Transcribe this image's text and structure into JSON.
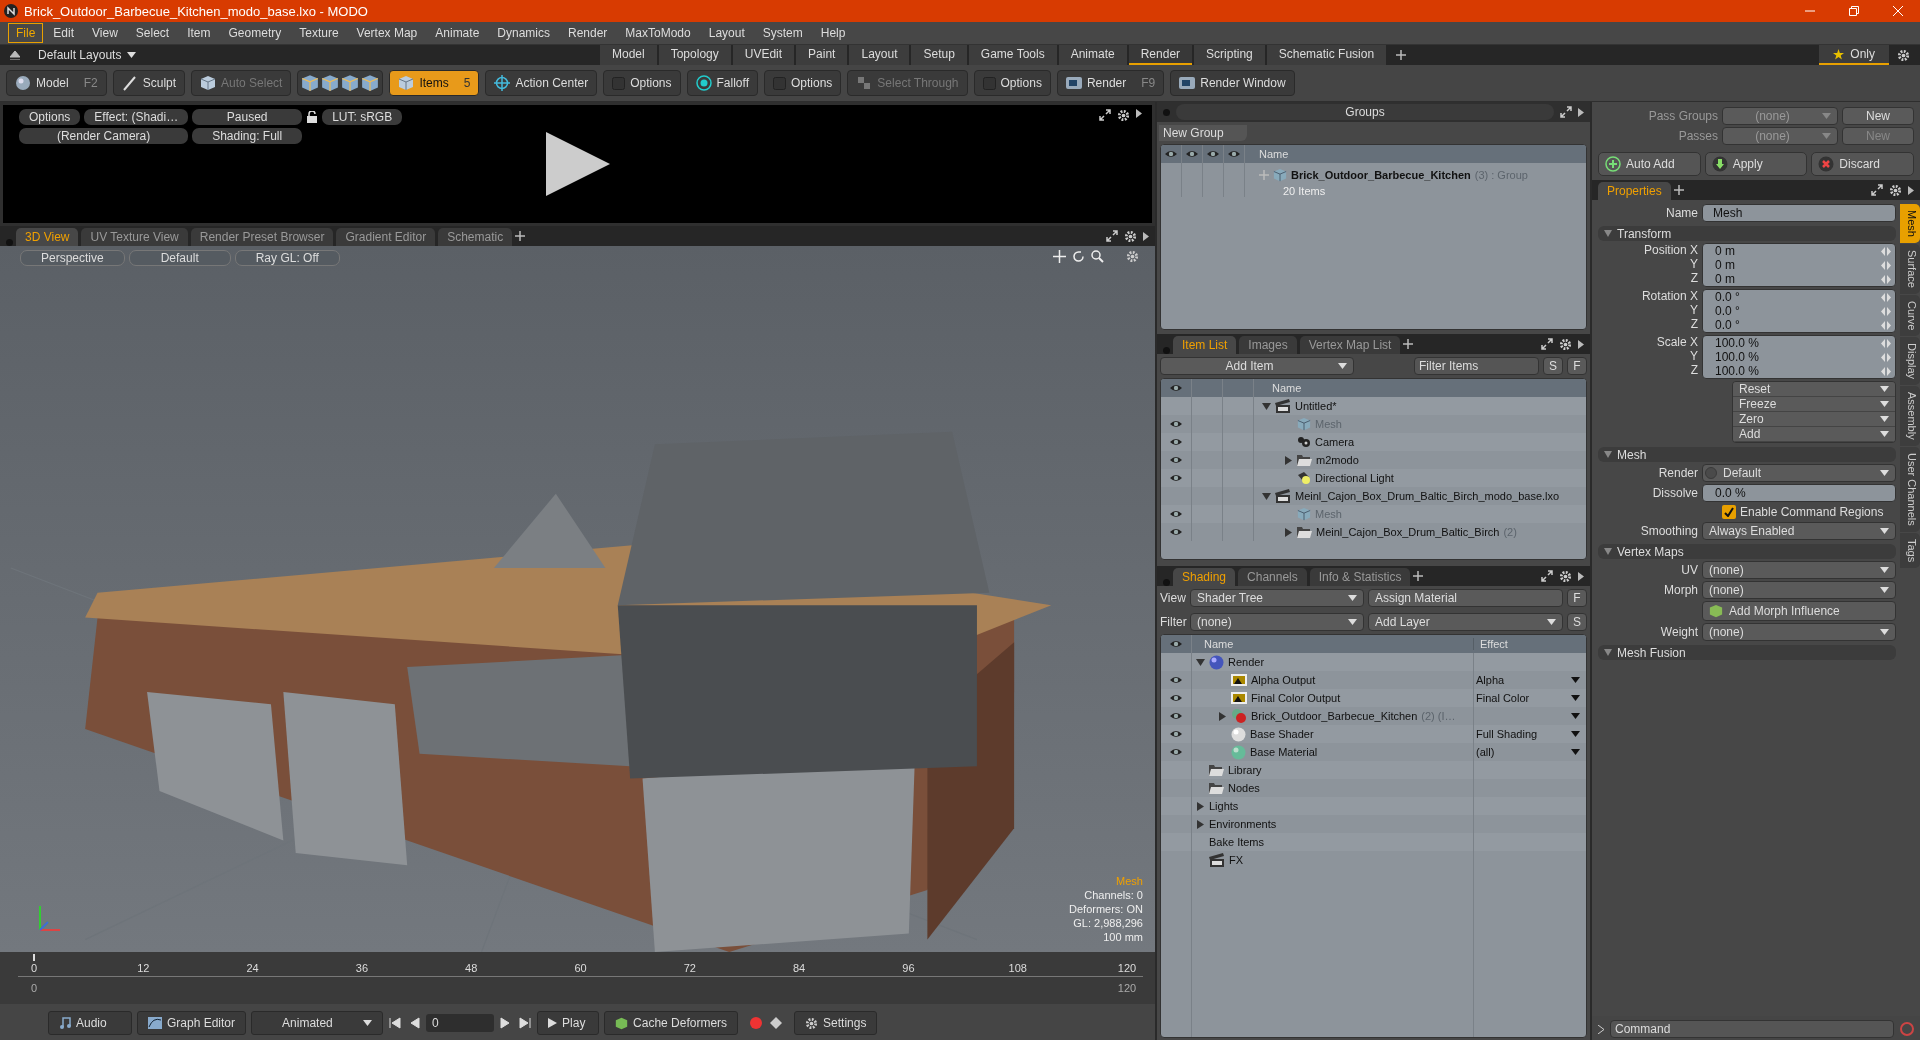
{
  "window": {
    "title": "Brick_Outdoor_Barbecue_Kitchen_modo_base.lxo - MODO"
  },
  "menu": [
    {
      "label": "File",
      "selected": true
    },
    {
      "label": "Edit",
      "selected": false
    },
    {
      "label": "View",
      "selected": false
    },
    {
      "label": "Select",
      "selected": false
    },
    {
      "label": "Item",
      "selected": false
    },
    {
      "label": "Geometry",
      "selected": false
    },
    {
      "label": "Texture",
      "selected": false
    },
    {
      "label": "Vertex Map",
      "selected": false
    },
    {
      "label": "Animate",
      "selected": false
    },
    {
      "label": "Dynamics",
      "selected": false
    },
    {
      "label": "Render",
      "selected": false
    },
    {
      "label": "MaxToModo",
      "selected": false
    },
    {
      "label": "Layout",
      "selected": false
    },
    {
      "label": "System",
      "selected": false
    },
    {
      "label": "Help",
      "selected": false
    }
  ],
  "layouts": {
    "label": "Default Layouts",
    "only": "Only",
    "tabs": [
      {
        "label": "Model",
        "selected": false
      },
      {
        "label": "Topology",
        "selected": false
      },
      {
        "label": "UVEdit",
        "selected": false
      },
      {
        "label": "Paint",
        "selected": false
      },
      {
        "label": "Layout",
        "selected": false
      },
      {
        "label": "Setup",
        "selected": false
      },
      {
        "label": "Game Tools",
        "selected": false
      },
      {
        "label": "Animate",
        "selected": false
      },
      {
        "label": "Render",
        "selected": true
      },
      {
        "label": "Scripting",
        "selected": false
      },
      {
        "label": "Schematic Fusion",
        "selected": false
      }
    ]
  },
  "toolbar": [
    {
      "kind": "sphere",
      "label": "Model",
      "key": "F2",
      "selected": false,
      "disabled": false
    },
    {
      "kind": "brush",
      "label": "Sculpt",
      "selected": false,
      "disabled": false
    },
    {
      "kind": "cube",
      "label": "Auto Select",
      "selected": false,
      "disabled": true
    },
    {
      "kind": "cube",
      "label": "Items",
      "key": "5",
      "selected": true,
      "disabled": false
    },
    {
      "kind": "target",
      "label": "Action Center",
      "selected": false,
      "disabled": false
    },
    {
      "kind": "checkbox",
      "label": "Options",
      "selected": false,
      "disabled": false
    },
    {
      "kind": "falloff",
      "label": "Falloff",
      "selected": false,
      "disabled": false
    },
    {
      "kind": "checkbox",
      "label": "Options",
      "selected": false,
      "disabled": false
    },
    {
      "kind": "select",
      "label": "Select Through",
      "selected": false,
      "disabled": true
    },
    {
      "kind": "checkbox",
      "label": "Options",
      "selected": false,
      "disabled": false
    },
    {
      "kind": "render",
      "label": "Render",
      "key": "F9",
      "selected": false,
      "disabled": false
    },
    {
      "kind": "render",
      "label": "Render Window",
      "selected": false,
      "disabled": false
    }
  ],
  "preview": {
    "buttons": [
      "Options",
      "Effect: (Shadi…",
      "Paused",
      "LUT: sRGB"
    ],
    "buttons_row2": [
      "(Render Camera)",
      "Shading: Full"
    ]
  },
  "view_tabs": [
    {
      "label": "3D View",
      "selected": true
    },
    {
      "label": "UV Texture View",
      "selected": false
    },
    {
      "label": "Render Preset Browser",
      "selected": false
    },
    {
      "label": "Gradient Editor",
      "selected": false
    },
    {
      "label": "Schematic",
      "selected": false
    }
  ],
  "viewport": {
    "buttons": [
      "Perspective",
      "Default",
      "Ray GL: Off"
    ],
    "info_title": "Mesh",
    "info": [
      "Channels: 0",
      "Deformers: ON",
      "GL: 2,988,296",
      "100 mm"
    ]
  },
  "timeline": {
    "ticks": [
      "0",
      "12",
      "24",
      "36",
      "48",
      "60",
      "72",
      "84",
      "96",
      "108",
      "120"
    ],
    "range": [
      "0",
      "120"
    ]
  },
  "bottom_bar": {
    "audio": "Audio",
    "graph_editor": "Graph Editor",
    "mode": "Animated",
    "frame": "0",
    "play": "Play",
    "cache": "Cache Deformers",
    "settings": "Settings"
  },
  "groups": {
    "title": "Groups",
    "new_group": "New Group",
    "column": "Name",
    "rows": [
      {
        "name": "Brick_Outdoor_Barbecue_Kitchen",
        "count": "(3)",
        "type": ": Group",
        "sub": "20 Items"
      }
    ]
  },
  "item_list": {
    "tabs": [
      {
        "label": "Item List",
        "selected": true
      },
      {
        "label": "Images",
        "selected": false
      },
      {
        "label": "Vertex Map List",
        "selected": false
      }
    ],
    "add_item": "Add Item",
    "filter": {
      "placeholder": "Filter Items"
    },
    "s": "S",
    "f": "F",
    "column": "Name",
    "items": [
      {
        "label": "Untitled*",
        "kind": "scene",
        "eye": false,
        "dimmed": false,
        "expanded": true,
        "children": [
          {
            "label": "Mesh",
            "kind": "mesh",
            "eye": true,
            "dimmed": true
          },
          {
            "label": "Camera",
            "kind": "camera",
            "eye": true,
            "dimmed": false
          },
          {
            "label": "m2modo",
            "kind": "folder",
            "eye": true,
            "dimmed": false,
            "expanded": false
          },
          {
            "label": "Directional Light",
            "kind": "light",
            "eye": true,
            "dimmed": false
          }
        ]
      },
      {
        "label": "Meinl_Cajon_Box_Drum_Baltic_Birch_modo_base.lxo",
        "kind": "scene",
        "eye": false,
        "dimmed": false,
        "expanded": true,
        "children": [
          {
            "label": "Mesh",
            "kind": "mesh",
            "eye": true,
            "dimmed": true
          },
          {
            "label": "Meinl_Cajon_Box_Drum_Baltic_Birch",
            "count": "(2)",
            "kind": "folder",
            "eye": true,
            "dimmed": false,
            "expanded": false
          }
        ]
      }
    ]
  },
  "shading": {
    "tabs": [
      {
        "label": "Shading",
        "selected": true
      },
      {
        "label": "Channels",
        "selected": false
      },
      {
        "label": "Info & Statistics",
        "selected": false
      }
    ],
    "view_label": "View",
    "view": "Shader Tree",
    "assign": "Assign Material",
    "f": "F",
    "filter_label": "Filter",
    "filter": "(none)",
    "add_layer": "Add Layer",
    "s": "S",
    "columns": [
      "Name",
      "Effect"
    ],
    "items": [
      {
        "label": "Render",
        "kind": "render",
        "eye": false,
        "expanded": true,
        "children": [
          {
            "label": "Alpha Output",
            "kind": "output",
            "eye": true,
            "effect": "Alpha",
            "dropdown": true
          },
          {
            "label": "Final Color Output",
            "kind": "output",
            "eye": true,
            "effect": "Final Color",
            "dropdown": true
          },
          {
            "label": "Brick_Outdoor_Barbecue_Kitchen",
            "count": "(2) (I…",
            "kind": "group",
            "eye": true,
            "expanded": false,
            "dropdown": true
          },
          {
            "label": "Base Shader",
            "kind": "shader",
            "eye": true,
            "effect": "Full Shading",
            "dropdown": true
          },
          {
            "label": "Base Material",
            "kind": "material",
            "eye": true,
            "effect": "(all)",
            "dropdown": true
          }
        ]
      },
      {
        "label": "Library",
        "kind": "folder",
        "eye": false
      },
      {
        "label": "Nodes",
        "kind": "folder",
        "eye": false
      },
      {
        "label": "Lights",
        "kind": "none",
        "eye": false,
        "expanded": false
      },
      {
        "label": "Environments",
        "kind": "none",
        "eye": false,
        "expanded": false
      },
      {
        "label": "Bake Items",
        "kind": "none",
        "eye": false
      },
      {
        "label": "FX",
        "kind": "clapper",
        "eye": false
      }
    ]
  },
  "passes": {
    "rows": [
      {
        "label": "Pass Groups",
        "value": "(none)",
        "button": "New",
        "disabled": false
      },
      {
        "label": "Passes",
        "value": "(none)",
        "button": "New",
        "disabled": true
      }
    ],
    "buttons": [
      {
        "kind": "add",
        "label": "Auto Add"
      },
      {
        "kind": "apply",
        "label": "Apply"
      },
      {
        "kind": "discard",
        "label": "Discard"
      }
    ]
  },
  "properties": {
    "tab": "Properties",
    "side_tabs": [
      {
        "label": "Mesh",
        "selected": true
      },
      {
        "label": "Surface",
        "selected": false
      },
      {
        "label": "Curve",
        "selected": false
      },
      {
        "label": "Display",
        "selected": false
      },
      {
        "label": "Assembly",
        "selected": false
      },
      {
        "label": "User Channels",
        "selected": false
      },
      {
        "label": "Tags",
        "selected": false
      }
    ],
    "name_label": "Name",
    "name": "Mesh",
    "sections": [
      {
        "title": "Transform",
        "rows": [
          {
            "kind": "vector",
            "rows": [
              {
                "label": "Position X",
                "value": "0 m"
              },
              {
                "label": "Y",
                "value": "0 m"
              },
              {
                "label": "Z",
                "value": "0 m"
              }
            ]
          },
          {
            "kind": "vector",
            "rows": [
              {
                "label": "Rotation X",
                "value": "0.0 °"
              },
              {
                "label": "Y",
                "value": "0.0 °"
              },
              {
                "label": "Z",
                "value": "0.0 °"
              }
            ]
          },
          {
            "kind": "vector",
            "rows": [
              {
                "label": "Scale X",
                "value": "100.0 %"
              },
              {
                "label": "Y",
                "value": "100.0 %"
              },
              {
                "label": "Z",
                "value": "100.0 %"
              }
            ]
          },
          {
            "kind": "actions",
            "items": [
              "Reset",
              "Freeze",
              "Zero",
              "Add"
            ]
          }
        ]
      },
      {
        "title": "Mesh",
        "rows": [
          {
            "kind": "dropdown",
            "label": "Render",
            "value": "Default",
            "dot": true
          },
          {
            "kind": "field",
            "label": "Dissolve",
            "value": "0.0 %"
          },
          {
            "kind": "checkbox",
            "label": "Enable Command Regions",
            "checked": true
          },
          {
            "kind": "dropdown",
            "label": "Smoothing",
            "value": "Always Enabled",
            "dot": false
          }
        ]
      },
      {
        "title": "Vertex Maps",
        "rows": [
          {
            "kind": "dropdown",
            "label": "UV",
            "value": "(none)",
            "dot": false
          },
          {
            "kind": "dropdown",
            "label": "Morph",
            "value": "(none)",
            "dot": false
          },
          {
            "kind": "button",
            "label": "Add Morph Influence"
          },
          {
            "kind": "dropdown",
            "label": "Weight",
            "value": "(none)",
            "dot": false
          }
        ]
      },
      {
        "title": "Mesh Fusion"
      }
    ]
  },
  "command": {
    "placeholder": "Command"
  }
}
